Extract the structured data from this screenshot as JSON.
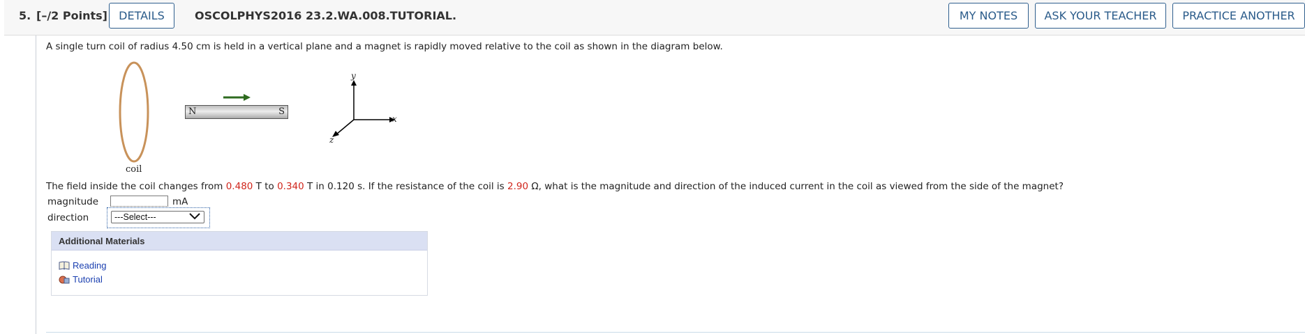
{
  "header": {
    "question_number": "5.",
    "points": "[–/2 Points]",
    "details_label": "DETAILS",
    "question_code": "OSCOLPHYS2016 23.2.WA.008.TUTORIAL.",
    "my_notes_label": "MY NOTES",
    "ask_teacher_label": "ASK YOUR TEACHER",
    "practice_another_label": "PRACTICE ANOTHER"
  },
  "question": {
    "prompt": "A single turn coil of radius 4.50 cm is held in a vertical plane and a magnet is rapidly moved relative to the coil as shown in the diagram below.",
    "sentence_part1": "The field inside the coil changes from ",
    "b_initial": "0.480",
    "sentence_part2": " T to ",
    "b_final": "0.340",
    "sentence_part3": " T in 0.120 s. If the resistance of the coil is ",
    "resistance": "2.90",
    "sentence_part4": " Ω, what is the magnitude and direction of the induced current in the coil as viewed from the side of the magnet?"
  },
  "diagram": {
    "coil_label": "coil",
    "magnet_north": "N",
    "magnet_south": "S",
    "axis_y": "y",
    "axis_x": "x",
    "axis_z": "z",
    "arrow_color": "#2e6b1f",
    "coil_color": "#c8925a"
  },
  "answers": {
    "magnitude_label": "magnitude",
    "magnitude_value": "",
    "magnitude_unit": "mA",
    "direction_label": "direction",
    "direction_selected": "---Select---"
  },
  "additional_materials": {
    "title": "Additional Materials",
    "links": [
      {
        "label": "Reading",
        "icon": "book-icon"
      },
      {
        "label": "Tutorial",
        "icon": "tutorial-icon"
      }
    ]
  }
}
